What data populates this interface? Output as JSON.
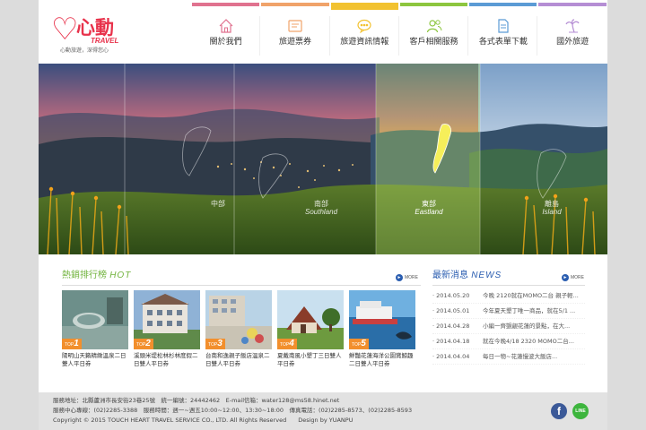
{
  "logo": {
    "brand": "心動",
    "travel": "TRAVEL",
    "slogan": "心動旅遊，深得您心"
  },
  "nav": [
    {
      "label": "關於我們",
      "icon": "home-icon",
      "color": "#e0728f"
    },
    {
      "label": "旅遊票券",
      "icon": "ticket-icon",
      "color": "#f0a36a"
    },
    {
      "label": "旅遊資訊情報",
      "icon": "chat-bubble-icon",
      "color": "#f2c230"
    },
    {
      "label": "客戶相關服務",
      "icon": "people-icon",
      "color": "#8dc63f"
    },
    {
      "label": "各式表單下載",
      "icon": "document-icon",
      "color": "#5b9bd5"
    },
    {
      "label": "國外旅遊",
      "icon": "palm-tree-icon",
      "color": "#b58ed4"
    }
  ],
  "nav_active_index": 2,
  "banner": {
    "regions": [
      {
        "zh": "中部",
        "en": ""
      },
      {
        "zh": "南部",
        "en": "Southland"
      },
      {
        "zh": "東部",
        "en": "Eastland"
      },
      {
        "zh": "離島",
        "en": "Island"
      }
    ],
    "active_region_index": 2
  },
  "hot": {
    "title_zh": "熱銷排行榜",
    "title_en": "HOT",
    "more": "MORE",
    "title_color": "#6fb23a",
    "items": [
      {
        "rank": "1",
        "top": "TOP",
        "caption": "陽明山天籟精緻溫泉二日雙人平日券"
      },
      {
        "rank": "2",
        "top": "TOP",
        "caption": "溪頭米堤松林杉林度假二日雙人平日券"
      },
      {
        "rank": "3",
        "top": "TOP",
        "caption": "台南和逸親子飯店溫泉二日雙人平日券"
      },
      {
        "rank": "4",
        "top": "TOP",
        "caption": "夏戴南風小墾丁三日雙人平日券"
      },
      {
        "rank": "5",
        "top": "TOP",
        "caption": "鮮豔花蓮海洋公園賞鯨趣二日雙人平日券"
      }
    ]
  },
  "news": {
    "title_zh": "最新消息",
    "title_en": "NEWS",
    "more": "MORE",
    "title_color": "#2a5db0",
    "items": [
      {
        "date": "· 2014.05.20",
        "text": "今晚 2120就在MOMO二台 親子輕..."
      },
      {
        "date": "· 2014.05.01",
        "text": "今年夏天墾丁唯一商品，就在5/1 ..."
      },
      {
        "date": "· 2014.04.28",
        "text": "小編一齊覬覦花蓮的景點，在大..."
      },
      {
        "date": "· 2014.04.18",
        "text": "就在今晚4/18 2320 MOMO二台..."
      },
      {
        "date": "· 2014.04.04",
        "text": "每日一物~花蓮慢波大飯店..."
      }
    ]
  },
  "footer": {
    "line1": "服務地址：北縣蘆洲市長安街23巷25號　統一編號：24442462　E-mail信箱：water128@ms58.hinet.net",
    "line2": "服務中心專線：(02)2285-3388　服務時間：週一~週五10:00~12:00、13:30~18:00　傳真電話：(02)2285-8573、(02)2285-8593",
    "line3": "Copyright © 2015 TOUCH HEART TRAVEL SERVICE CO., LTD. All Rights Reserved　　Design by YUANPU",
    "facebook": "f",
    "line_app": "LINE",
    "facebook_color": "#3b5998",
    "line_color": "#3db53d"
  }
}
